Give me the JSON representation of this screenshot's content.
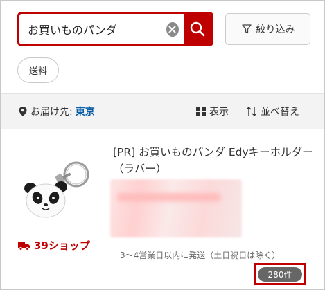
{
  "search": {
    "value": "お買いものパンダ",
    "placeholder": ""
  },
  "filter": {
    "label": "絞り込み"
  },
  "chips": [
    {
      "label": "送料"
    }
  ],
  "bar": {
    "delivery_prefix": "お届け先:",
    "delivery_city": "東京",
    "view_label": "表示",
    "sort_label": "並べ替え"
  },
  "product": {
    "title": "[PR] お買いものパンダ Edyキーホルダー（ラバー）",
    "shop": "39ショップ",
    "shipping": "3～4営業日以内に発送（土日祝日は除く）",
    "count": "280件"
  },
  "colors": {
    "brand": "#bf0000",
    "city": "#0b5ea8"
  },
  "icons": [
    "clear-icon",
    "search-icon",
    "filter-icon",
    "location-pin-icon",
    "grid-view-icon",
    "sort-arrows-icon",
    "truck-icon"
  ]
}
